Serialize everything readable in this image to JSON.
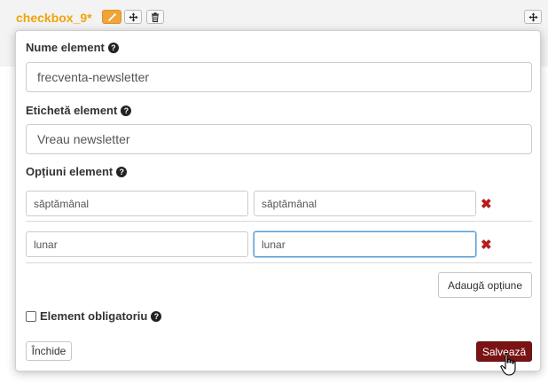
{
  "toolbar": {
    "field_title": "checkbox_9*",
    "edit_icon": "pencil-icon",
    "move_icon": "move-arrows-icon",
    "delete_icon": "trash-icon"
  },
  "dialog": {
    "element_name_label": "Nume element",
    "element_name_value": "frecventa-newsletter",
    "element_label_label": "Etichetă element",
    "element_label_value": "Vreau newsletter",
    "options_label": "Opțiuni element",
    "options": [
      {
        "value": "săptămânal",
        "label": "săptămânal"
      },
      {
        "value": "lunar",
        "label": "lunar"
      }
    ],
    "add_option_label": "Adaugă opțiune",
    "required_label": "Element obligatoriu",
    "required_checked": false,
    "close_label": "Închide",
    "save_label": "Salvează",
    "help_icon": "question-circle-icon",
    "remove_icon": "remove-x-icon"
  },
  "colors": {
    "title": "#f0a30a",
    "edit_button": "#f0a53a",
    "save_button": "#7a1414",
    "remove": "#b51e1e"
  }
}
